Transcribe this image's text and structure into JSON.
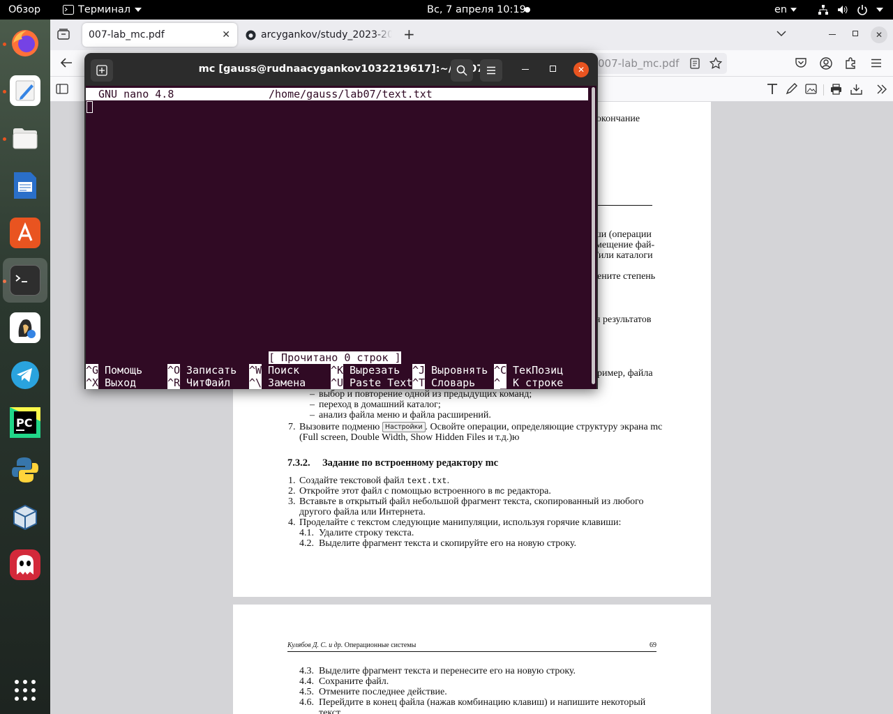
{
  "topbar": {
    "activities": "Обзор",
    "app_menu": "Терминал",
    "clock": "Вс, 7 апреля  10:19",
    "keyboard_layout": "en"
  },
  "browser": {
    "tabs": [
      {
        "title": "007-lab_mc.pdf",
        "active": true
      },
      {
        "title": "arcygankov/study_2023-2024_os-intro"
      }
    ],
    "url_fragment": "007-lab_mc.pdf"
  },
  "terminal": {
    "title": "mc [gauss@rudnaacygankov1032219617]:~/lab07",
    "nano_version": "GNU nano 4.8",
    "file_path": "/home/gauss/lab07/text.txt",
    "status_message": "[ Прочитано 0 строк ]",
    "shortcuts": [
      {
        "key": "^G",
        "label": "Помощь"
      },
      {
        "key": "^O",
        "label": "Записать"
      },
      {
        "key": "^W",
        "label": "Поиск"
      },
      {
        "key": "^K",
        "label": "Вырезать"
      },
      {
        "key": "^J",
        "label": "Выровнять"
      },
      {
        "key": "^C",
        "label": "ТекПозиц"
      },
      {
        "key": "^X",
        "label": "Выход"
      },
      {
        "key": "^R",
        "label": "ЧитФайл"
      },
      {
        "key": "^\\",
        "label": "Замена"
      },
      {
        "key": "^U",
        "label": "Paste Text"
      },
      {
        "key": "^T",
        "label": "Словарь"
      },
      {
        "key": "^_",
        "label": "К строке"
      }
    ]
  },
  "pdf": {
    "partial_right": [
      "окончание",
      "ши (операции",
      "мещение фай-",
      "/или каталоги",
      "ените степень",
      "я результатов",
      "ример, файла"
    ],
    "bullets": [
      "выбор и повторение одной из предыдущих команд;",
      "переход в домашний каталог;",
      "анализ файла меню и файла расширений."
    ],
    "item7": {
      "num": "7.",
      "before": "Вызовите подменю",
      "button": "Настройки",
      "after": ". Освойте операции, определяющие структуру экрана mc",
      "line2": "(Full screen, Double Width, Show Hidden Files и т.д.)ю"
    },
    "section": {
      "num": "7.3.2.",
      "title": "Задание по встроенному редактору mc"
    },
    "items": {
      "i1_num": "1.",
      "i1_before": "Создайте текстовой файл ",
      "i1_code": "text.txt",
      "i1_after": ".",
      "i2_num": "2.",
      "i2_before": "Откройте этот файл с помощью встроенного в ",
      "i2_code": "mc",
      "i2_after": " редактора.",
      "i3_num": "3.",
      "i3_line1": "Вставьте в открытый файл небольшой фрагмент текста, скопированный из любого",
      "i3_line2": "другого файла или Интернета.",
      "i4_num": "4.",
      "i4": "Проделайте с текстом следующие манипуляции, используя горячие клавиши:",
      "s41_num": "4.1.",
      "s41": "Удалите строку текста.",
      "s42_num": "4.2.",
      "s42": "Выделите фрагмент текста и скопируйте его на новую строку."
    },
    "footer": {
      "authors": "Кулябов Д. С. и др.",
      "book": "Операционные системы",
      "page": "69"
    },
    "items2": [
      {
        "num": "4.3.",
        "text": "Выделите фрагмент текста и перенесите его на новую строку."
      },
      {
        "num": "4.4.",
        "text": "Сохраните файл."
      },
      {
        "num": "4.5.",
        "text": "Отмените последнее действие."
      },
      {
        "num": "4.6.",
        "text": "Перейдите в конец файла (нажав комбинацию клавиш) и напишите некоторый"
      }
    ],
    "last_partial": "текст"
  }
}
